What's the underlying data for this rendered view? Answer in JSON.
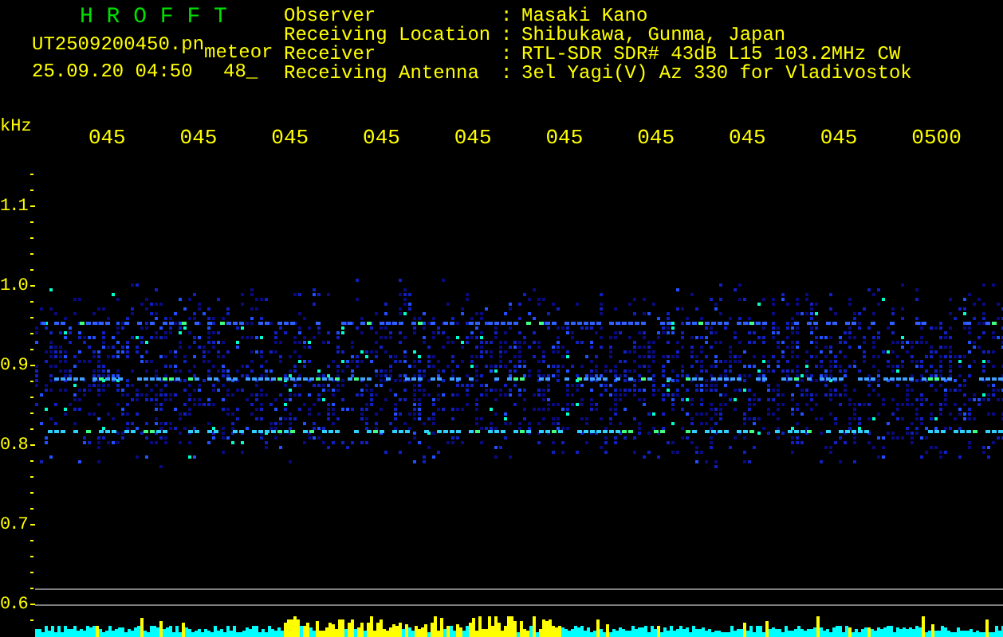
{
  "app": {
    "title": "H R O F F T",
    "file_name": "UT2509200450.pn",
    "mode": "meteor",
    "datetime": "25.09.20 04:50",
    "count": "48_"
  },
  "station": [
    {
      "label": "Observer",
      "separator": ":",
      "value": "Masaki Kano"
    },
    {
      "label": "Receiving Location",
      "separator": ":",
      "value": "Shibukawa, Gunma, Japan"
    },
    {
      "label": "Receiver",
      "separator": ":",
      "value": "RTL-SDR SDR# 43dB L15 103.2MHz CW"
    },
    {
      "label": "Receiving Antenna",
      "separator": ":",
      "value": "3el Yagi(V) Az 330 for Vladivostok"
    }
  ],
  "axis": {
    "unit": "kHz",
    "time_labels": [
      "045",
      "045",
      "045",
      "045",
      "045",
      "045",
      "045",
      "045",
      "045",
      "0500"
    ],
    "freq_labels": [
      "1.1",
      "1.0",
      "0.9",
      "0.8",
      "0.7",
      "0.6"
    ]
  }
}
